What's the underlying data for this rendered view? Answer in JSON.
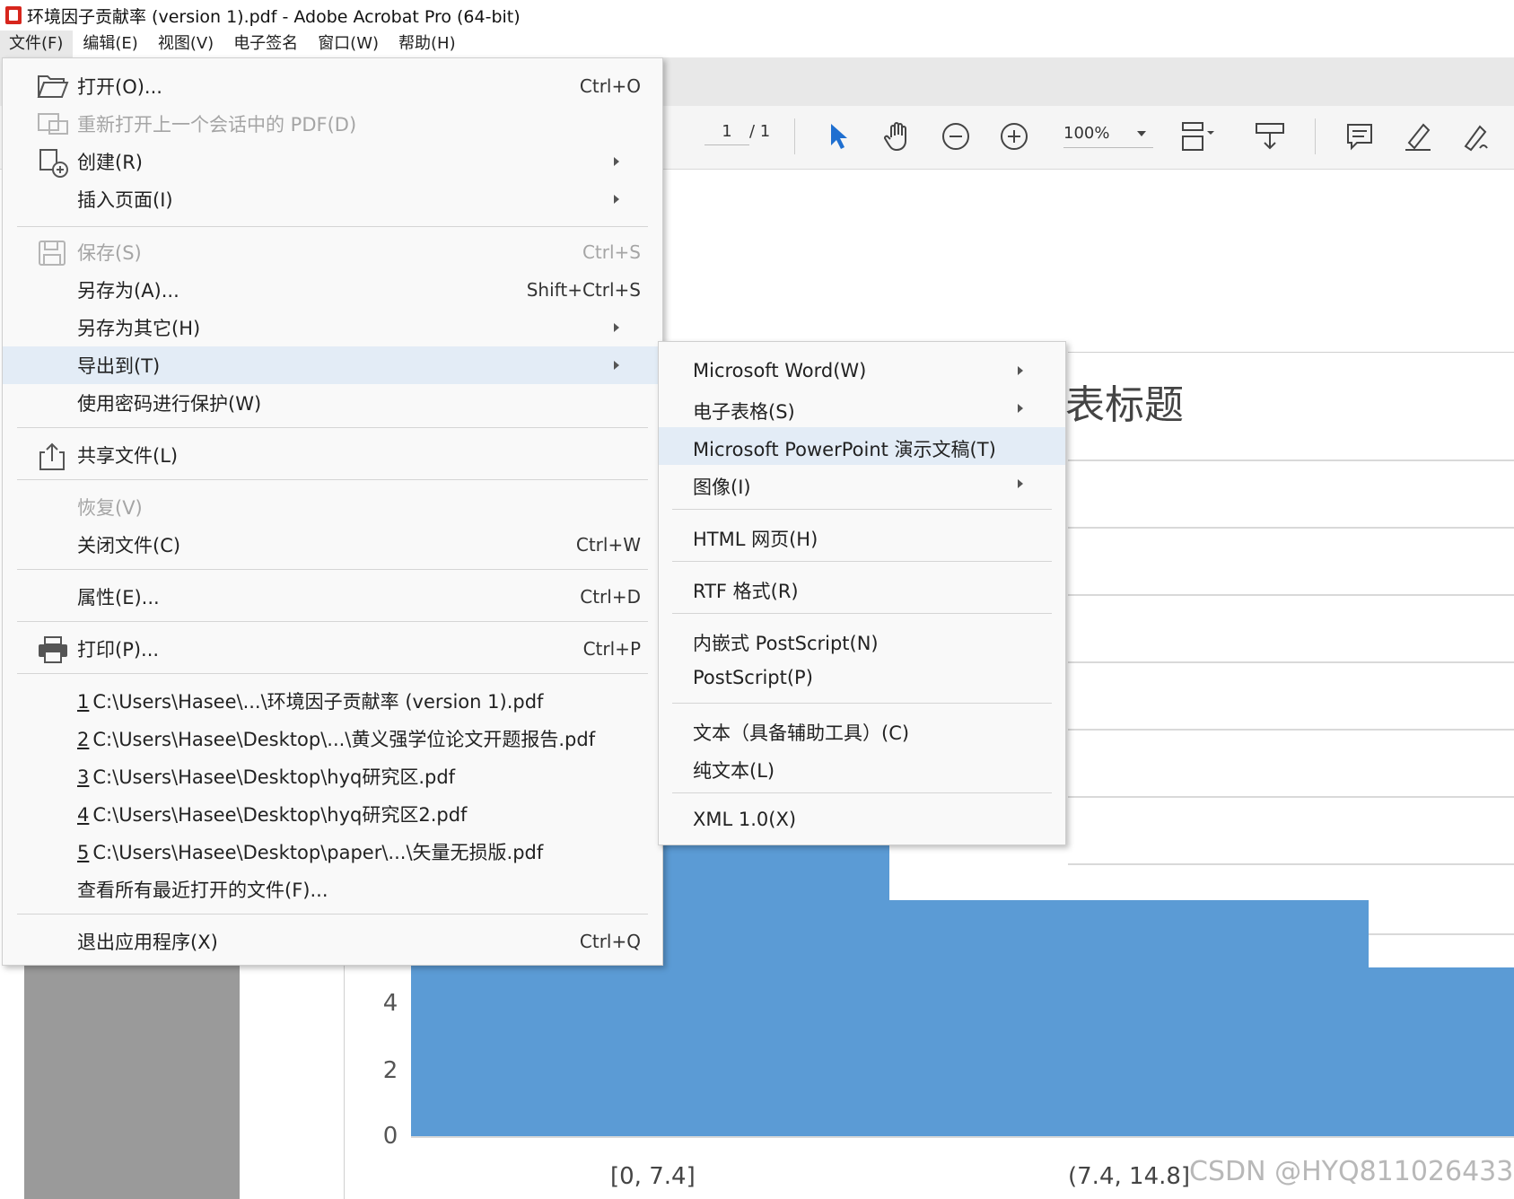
{
  "window": {
    "title": "环境因子贡献率 (version 1).pdf - Adobe Acrobat Pro (64-bit)"
  },
  "menubar": [
    "文件(F)",
    "编辑(E)",
    "视图(V)",
    "电子签名",
    "窗口(W)",
    "帮助(H)"
  ],
  "toolbar": {
    "page_current": "1",
    "page_total": "/ 1",
    "zoom": "100%"
  },
  "file_menu": {
    "open": {
      "label": "打开(O)...",
      "shortcut": "Ctrl+O"
    },
    "reopen": {
      "label": "重新打开上一个会话中的 PDF(D)"
    },
    "create": {
      "label": "创建(R)"
    },
    "insert_pages": {
      "label": "插入页面(I)"
    },
    "save": {
      "label": "保存(S)",
      "shortcut": "Ctrl+S"
    },
    "save_as": {
      "label": "另存为(A)...",
      "shortcut": "Shift+Ctrl+S"
    },
    "save_as_other": {
      "label": "另存为其它(H)"
    },
    "export_to": {
      "label": "导出到(T)"
    },
    "protect": {
      "label": "使用密码进行保护(W)"
    },
    "share": {
      "label": "共享文件(L)"
    },
    "revert": {
      "label": "恢复(V)"
    },
    "close": {
      "label": "关闭文件(C)",
      "shortcut": "Ctrl+W"
    },
    "properties": {
      "label": "属性(E)...",
      "shortcut": "Ctrl+D"
    },
    "print": {
      "label": "打印(P)...",
      "shortcut": "Ctrl+P"
    },
    "recent": [
      {
        "num": "1",
        "path": "C:\\Users\\Hasee\\...\\环境因子贡献率 (version 1).pdf"
      },
      {
        "num": "2",
        "path": "C:\\Users\\Hasee\\Desktop\\...\\黄义强学位论文开题报告.pdf"
      },
      {
        "num": "3",
        "path": "C:\\Users\\Hasee\\Desktop\\hyq研究区.pdf"
      },
      {
        "num": "4",
        "path": "C:\\Users\\Hasee\\Desktop\\hyq研究区2.pdf"
      },
      {
        "num": "5",
        "path": "C:\\Users\\Hasee\\Desktop\\paper\\...\\矢量无损版.pdf"
      }
    ],
    "view_all_recent": {
      "label": "查看所有最近打开的文件(F)..."
    },
    "exit": {
      "label": "退出应用程序(X)",
      "shortcut": "Ctrl+Q"
    }
  },
  "export_submenu": {
    "word": "Microsoft Word(W)",
    "spreadsheet": "电子表格(S)",
    "powerpoint": "Microsoft PowerPoint 演示文稿(T)",
    "image": "图像(I)",
    "html": "HTML 网页(H)",
    "rtf": "RTF 格式(R)",
    "embedded_ps": "内嵌式 PostScript(N)",
    "postscript": "PostScript(P)",
    "text_accessible": "文本（具备辅助工具）(C)",
    "plain_text": "纯文本(L)",
    "xml": "XML 1.0(X)"
  },
  "document": {
    "chart_title_fragment": "表标题",
    "y_ticks": [
      "0",
      "2",
      "4"
    ],
    "x_ticks": [
      "[0, 7.4]",
      "(7.4, 14.8]"
    ],
    "watermark": "CSDN @HYQ811026433"
  },
  "colors": {
    "bar": "#5b9bd5",
    "menu_highlight": "#e3ecf6",
    "pdf_red": "#d7261d"
  }
}
